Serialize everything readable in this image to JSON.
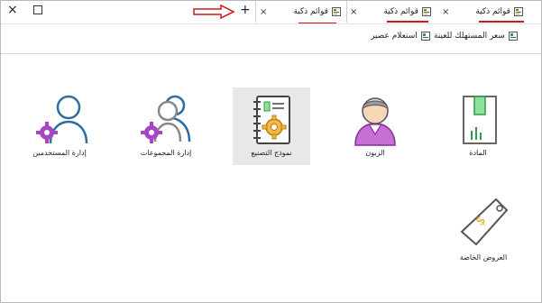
{
  "window": {
    "close_glyph": "×",
    "new_tab_glyph": "+"
  },
  "tabs": [
    {
      "label": "قوائم ذكية",
      "close": "×"
    },
    {
      "label": "قوائم ذكية",
      "close": "×"
    },
    {
      "label": "قوائم ذكية",
      "close": "×"
    }
  ],
  "toolbar": {
    "price_button": "سعر المستهلك للعينة",
    "query_button": "استعلام عصير"
  },
  "tiles": [
    {
      "label": "المادة",
      "icon": "box-icon"
    },
    {
      "label": "الزبون",
      "icon": "customer-icon"
    },
    {
      "label": "نموذج التصنيع",
      "icon": "manufacturing-notebook-icon"
    },
    {
      "label": "إدارة المجموعات",
      "icon": "groups-gear-icon"
    },
    {
      "label": "إدارة المستخدمين",
      "icon": "user-gear-icon"
    },
    {
      "label": "العروض الخاصة",
      "icon": "price-tag-icon"
    }
  ],
  "colors": {
    "accent_red": "#d01818",
    "icon_blue": "#2c6ea3",
    "icon_purple": "#a347c2",
    "icon_green": "#2e9b4d",
    "icon_orange": "#e8a325"
  }
}
